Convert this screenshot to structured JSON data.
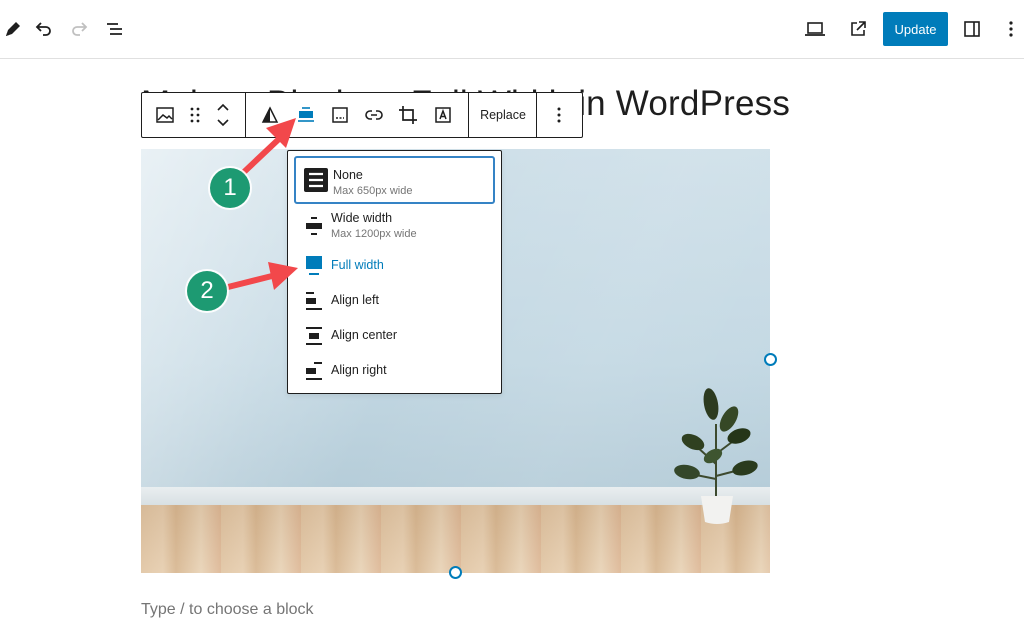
{
  "topbar": {
    "left_icons": [
      "pencil-icon",
      "undo-icon",
      "redo-icon",
      "list-view-icon"
    ],
    "right_icons": [
      "preview-device-icon",
      "external-link-icon",
      "sidebar-toggle-icon",
      "more-options-icon"
    ],
    "update_label": "Update"
  },
  "editor": {
    "title": "Make a Block as Full Width in WordPress",
    "placeholder": "Type / to choose a block"
  },
  "block_toolbar": {
    "tools": [
      "image-block-icon",
      "drag-handle-icon",
      "move-up-down-icon",
      "duotone-icon",
      "align-icon",
      "caption-icon",
      "link-icon",
      "crop-icon",
      "text-overlay-icon"
    ],
    "replace_label": "Replace",
    "more_icon": "more-options-icon"
  },
  "align_menu": {
    "options": [
      {
        "label": "None",
        "sub": "Max 650px wide",
        "icon": "align-none-icon",
        "selected": true
      },
      {
        "label": "Wide width",
        "sub": "Max 1200px wide",
        "icon": "align-wide-icon"
      },
      {
        "label": "Full width",
        "sub": "",
        "icon": "align-full-icon",
        "active": true
      },
      {
        "label": "Align left",
        "sub": "",
        "icon": "align-left-icon"
      },
      {
        "label": "Align center",
        "sub": "",
        "icon": "align-center-icon"
      },
      {
        "label": "Align right",
        "sub": "",
        "icon": "align-right-icon"
      }
    ]
  },
  "annotations": {
    "step1": "1",
    "step2": "2",
    "color": "#1d9a72",
    "arrow_color": "#f2484b"
  },
  "colors": {
    "accent": "#007cba",
    "text": "#1e1e1e",
    "muted": "#757575"
  }
}
